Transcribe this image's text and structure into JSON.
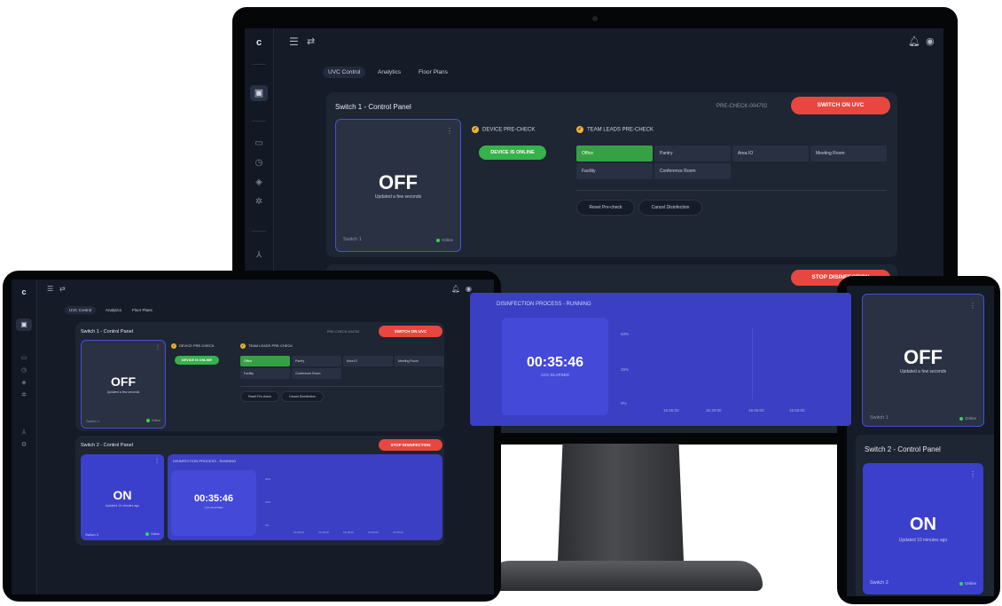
{
  "app": {
    "logo": "c"
  },
  "tabs": [
    "UVC Control",
    "Analytics",
    "Floor Plans"
  ],
  "switch1": {
    "title": "Switch 1 - Control Panel",
    "precheck_id": "PRE-CHECK-004702",
    "action_label": "SWITCH ON UVC",
    "state": "OFF",
    "updated": "Updated a few seconds",
    "switch_label": "Switch 1",
    "online_label": "Online",
    "device_check_label": "DEVICE PRE-CHECK",
    "device_status": "DEVICE IS ONLINE",
    "team_check_label": "TEAM LEADS PRE-CHECK",
    "teams": [
      "Office",
      "Pantry",
      "Area IO",
      "Meeting Room",
      "Facility",
      "Conference Room"
    ],
    "reset_label": "Reset Pre-check",
    "cancel_label": "Cancel Disinfection"
  },
  "switch2": {
    "title": "Switch 2 - Control Panel",
    "action_label": "STOP DISINFECTION",
    "state": "ON",
    "updated": "Updated 10 minutes ago",
    "switch_label": "Switch 2",
    "online_label": "Online",
    "process_label": "DISINFECTION PROCESS - RUNNING",
    "timer": "00:35:46",
    "timer_label": "UVC ELAPSED"
  },
  "chart_axis": {
    "y_labels": [
      "50%",
      "25%",
      "0%"
    ],
    "x_labels": [
      "15:35:00",
      "15:40:00",
      "15:45:00",
      "15:50:00",
      "15:55:00"
    ]
  },
  "colors": {
    "accent_red": "#e8473f",
    "accent_green": "#36b24a",
    "on_blue": "#3b40cc"
  }
}
